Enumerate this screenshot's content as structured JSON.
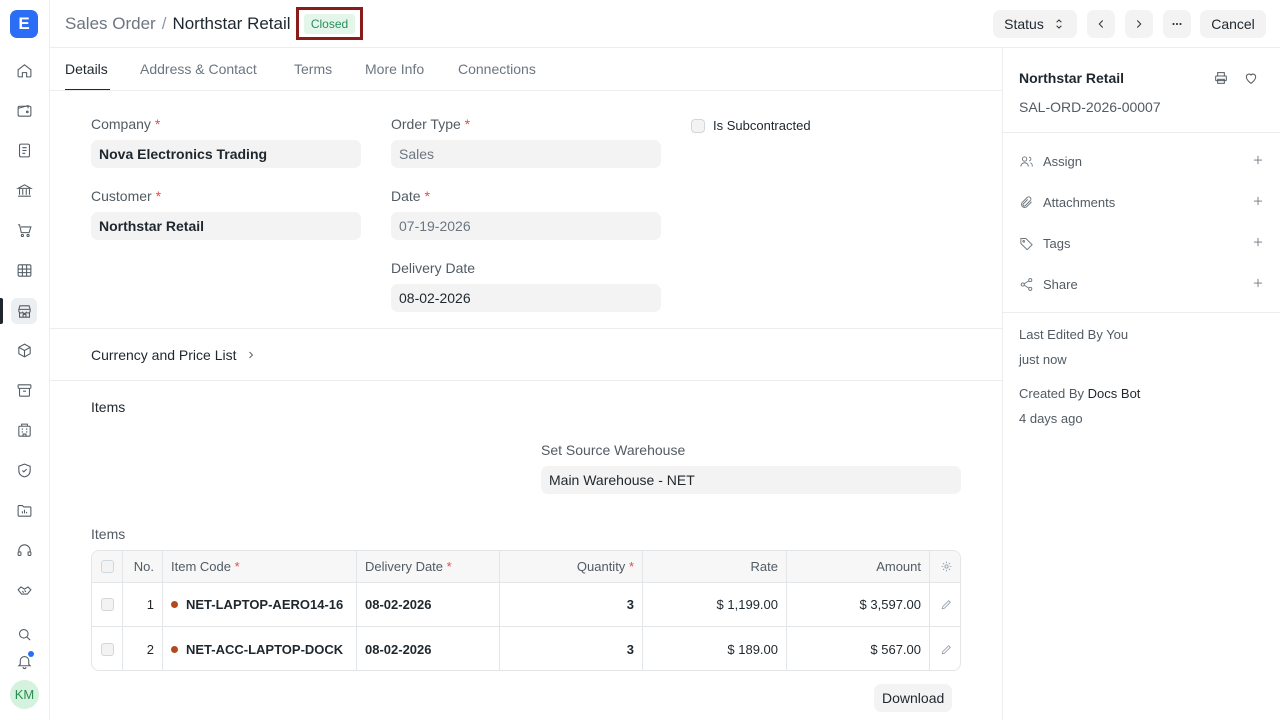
{
  "app": {
    "logo_letter": "E",
    "avatar_initials": "KM"
  },
  "header": {
    "doctype": "Sales Order",
    "separator": "/",
    "title": "Northstar Retail",
    "status": "Closed",
    "status_button": "Status",
    "cancel_button": "Cancel"
  },
  "tabs": [
    "Details",
    "Address & Contact",
    "Terms",
    "More Info",
    "Connections"
  ],
  "form": {
    "company_label": "Company",
    "company_value": "Nova Electronics Trading",
    "customer_label": "Customer",
    "customer_value": "Northstar Retail",
    "order_type_label": "Order Type",
    "order_type_value": "Sales",
    "date_label": "Date",
    "date_value": "07-19-2026",
    "delivery_date_label": "Delivery Date",
    "delivery_date_value": "08-02-2026",
    "is_subcontracted_label": "Is Subcontracted",
    "currency_section": "Currency and Price List",
    "items_section": "Items",
    "source_warehouse_label": "Set Source Warehouse",
    "source_warehouse_value": "Main Warehouse - NET",
    "items_table_label": "Items"
  },
  "items_table": {
    "headers": {
      "no": "No.",
      "item_code": "Item Code",
      "delivery_date": "Delivery Date",
      "quantity": "Quantity",
      "rate": "Rate",
      "amount": "Amount"
    },
    "rows": [
      {
        "no": "1",
        "item_code": "NET-LAPTOP-AERO14-16",
        "delivery_date": "08-02-2026",
        "quantity": "3",
        "rate": "$ 1,199.00",
        "amount": "$ 3,597.00"
      },
      {
        "no": "2",
        "item_code": "NET-ACC-LAPTOP-DOCK",
        "delivery_date": "08-02-2026",
        "quantity": "3",
        "rate": "$ 189.00",
        "amount": "$ 567.00"
      }
    ],
    "download_button": "Download"
  },
  "sidebar": {
    "title": "Northstar Retail",
    "doc_id": "SAL-ORD-2026-00007",
    "items": [
      "Assign",
      "Attachments",
      "Tags",
      "Share"
    ],
    "last_edited": "Last Edited By You",
    "last_edited_time": "just now",
    "created_prefix": "Created By",
    "created_by": "Docs Bot",
    "created_time": "4 days ago"
  },
  "colors": {
    "accent": "#2b6ef5",
    "status_bg": "#e4f5e9",
    "status_text": "#278f5e",
    "required": "#e24c4c",
    "highlight_border": "#8b1a1a"
  }
}
